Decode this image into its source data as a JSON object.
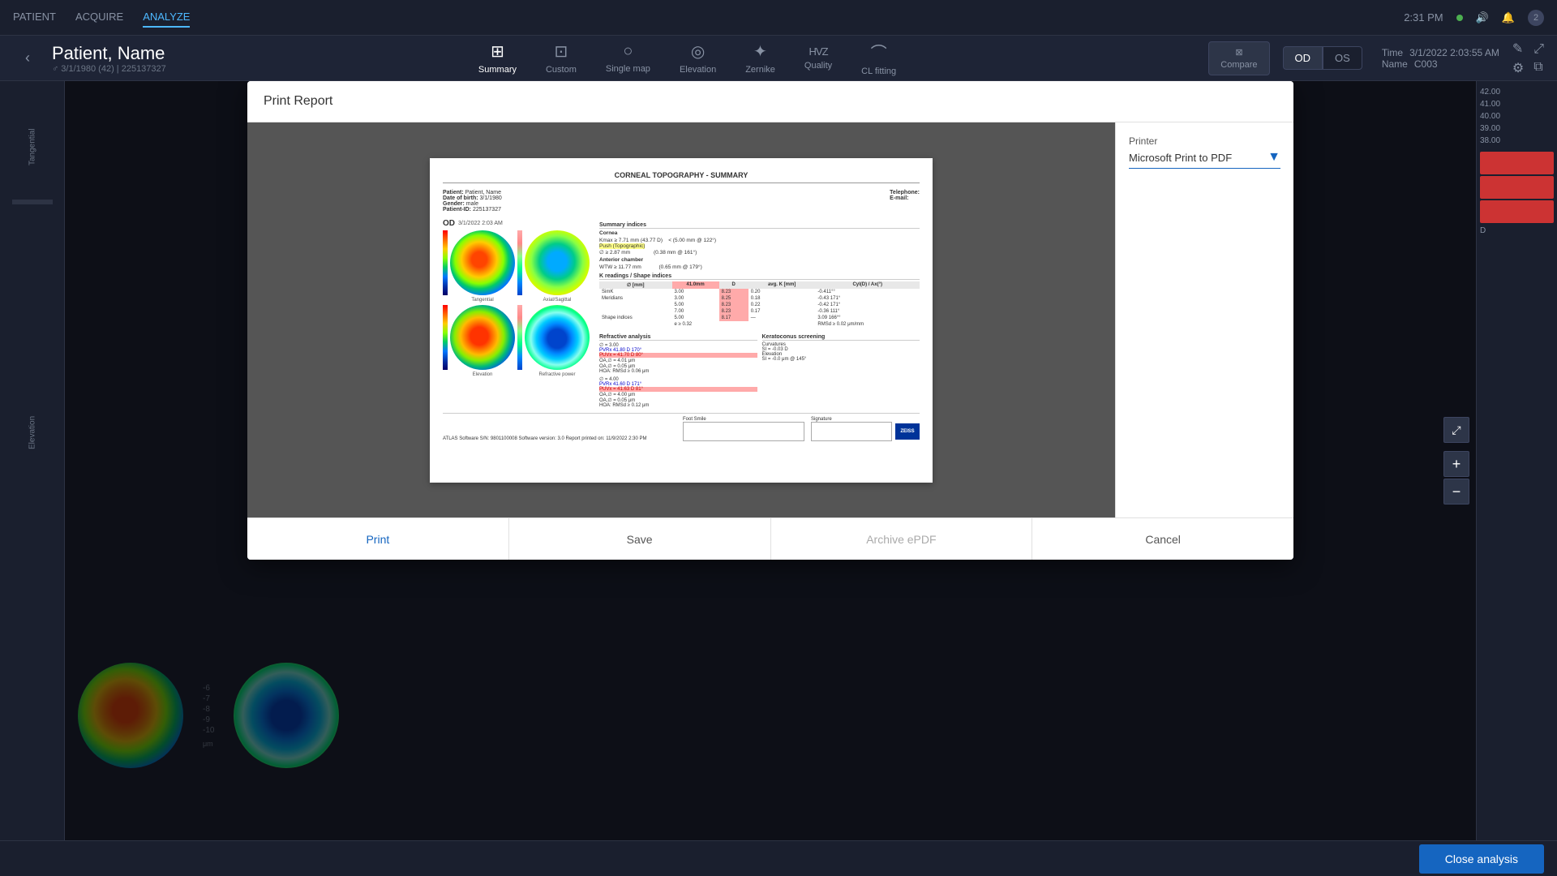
{
  "app": {
    "nav": {
      "items": [
        {
          "label": "PATIENT",
          "active": false
        },
        {
          "label": "ACQUIRE",
          "active": false
        },
        {
          "label": "ANALYZE",
          "active": true
        }
      ]
    },
    "topRight": {
      "time": "2:31 PM",
      "statusDot": "online",
      "version": "2"
    }
  },
  "header": {
    "backButton": "‹",
    "patientName": "Patient, Name",
    "patientSub": "♂  3/1/1980 (42)  |  225137327",
    "toolbar": {
      "items": [
        {
          "id": "summary",
          "label": "Summary",
          "icon": "⊞",
          "active": true
        },
        {
          "id": "custom",
          "label": "Custom",
          "icon": "⊡"
        },
        {
          "id": "single-map",
          "label": "Single map",
          "icon": "○"
        },
        {
          "id": "elevation",
          "label": "Elevation",
          "icon": "◎"
        },
        {
          "id": "zernike",
          "label": "Zernike",
          "icon": "✦"
        },
        {
          "id": "quality",
          "label": "Quality",
          "icon": "HVZ"
        },
        {
          "id": "cl-fitting",
          "label": "CL fitting",
          "icon": "⌒"
        }
      ]
    },
    "compareBtn": "Compare",
    "od": "OD",
    "os": "OS",
    "time": "3/1/2022 2:03:55 AM",
    "name": "C003",
    "timeLabel": "Time",
    "nameLabel": "Name"
  },
  "sidebar": {
    "labels": [
      {
        "label": "Tangential"
      },
      {
        "label": "Elevation"
      }
    ]
  },
  "modal": {
    "title": "Print Report",
    "printer": {
      "label": "Printer",
      "selected": "Microsoft Print to PDF"
    },
    "footer": {
      "print": "Print",
      "save": "Save",
      "archiveEpdf": "Archive ePDF",
      "cancel": "Cancel"
    },
    "report": {
      "mainTitle": "CORNEAL TOPOGRAPHY - SUMMARY",
      "patientLabel": "Patient:",
      "patientName": "Patient, Name",
      "dobLabel": "Date of birth:",
      "dob": "3/1/1980",
      "genderLabel": "Gender:",
      "gender": "male",
      "idLabel": "Patient-ID:",
      "id": "225137327",
      "phoneLabel": "Telephone:",
      "emailLabel": "E-mail:",
      "odLabel": "OD",
      "dateTime": "3/1/2022 2:03 AM",
      "tangentialLabel": "Tangential",
      "elevationLabel": "Elevation",
      "axialSagittalLabel": "Axial/Sagittal",
      "refractivePowerLabel": "Refractive power",
      "footSmileLabel": "Foot Smile",
      "signatureLabel": "Signature",
      "softwareInfo": "ATLAS Software    S/N: 9801100008    Software version: 3.0    Report printed on: 11/9/2022 2:30 PM",
      "summaryIndicesTitle": "Summary indices",
      "corneaTitle": "Cornea",
      "anteriorChamberTitle": "Anterior chamber",
      "kReadingsTitle": "K readings / Shape indices",
      "refractiveTitle": "Refractive analysis",
      "keratoconusTitle": "Keratoconus screening"
    },
    "zoomControls": {
      "expand": "⤢",
      "plus": "+",
      "minus": "−"
    }
  },
  "bottomBar": {
    "closeAnalysis": "Close analysis"
  },
  "background": {
    "scaleValues": [
      "-6",
      "-7",
      "-8",
      "-9",
      "-10"
    ],
    "rightScaleValues": [
      "42.00",
      "41.00",
      "40.00",
      "39.00",
      "38.00"
    ],
    "unit": "μm",
    "unitD": "D"
  }
}
